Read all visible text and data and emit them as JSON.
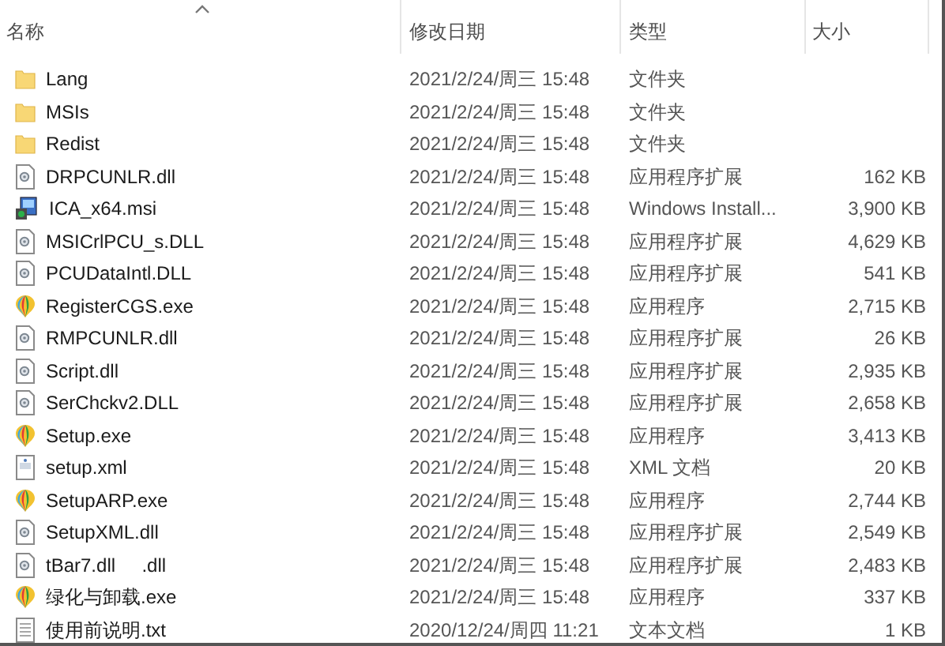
{
  "columns": [
    {
      "label": "名称",
      "sorted": true
    },
    {
      "label": "修改日期",
      "sorted": false
    },
    {
      "label": "类型",
      "sorted": false
    },
    {
      "label": "大小",
      "sorted": false
    }
  ],
  "rows": [
    {
      "kind": "folder",
      "name": "Lang",
      "date": "2021/2/24/周三 15:48",
      "type": "文件夹"
    },
    {
      "kind": "folder",
      "name": "MSIs",
      "date": "2021/2/24/周三 15:48",
      "type": "文件夹"
    },
    {
      "kind": "folder",
      "name": "Redist",
      "date": "2021/2/24/周三 15:48",
      "type": "文件夹"
    },
    {
      "kind": "dll",
      "name": "DRPCUNLR.dll",
      "date": "2021/2/24/周三 15:48",
      "type": "应用程序扩展",
      "size": "162 KB"
    },
    {
      "kind": "msi",
      "name": "ICA_x64.msi",
      "date": "2021/2/24/周三 15:48",
      "type": "Windows Install...",
      "size": "3,900 KB"
    },
    {
      "kind": "dll",
      "name": "MSICrlPCU_s.DLL",
      "date": "2021/2/24/周三 15:48",
      "type": "应用程序扩展",
      "size": "4,629 KB"
    },
    {
      "kind": "dll",
      "name": "PCUDataIntl.DLL",
      "date": "2021/2/24/周三 15:48",
      "type": "应用程序扩展",
      "size": "541 KB"
    },
    {
      "kind": "exe",
      "name": "RegisterCGS.exe",
      "date": "2021/2/24/周三 15:48",
      "type": "应用程序",
      "size": "2,715 KB"
    },
    {
      "kind": "dll",
      "name": "RMPCUNLR.dll",
      "date": "2021/2/24/周三 15:48",
      "type": "应用程序扩展",
      "size": "26 KB"
    },
    {
      "kind": "dll",
      "name": "Script.dll",
      "date": "2021/2/24/周三 15:48",
      "type": "应用程序扩展",
      "size": "2,935 KB"
    },
    {
      "kind": "dll",
      "name": "SerChckv2.DLL",
      "date": "2021/2/24/周三 15:48",
      "type": "应用程序扩展",
      "size": "2,658 KB"
    },
    {
      "kind": "exe",
      "name": "Setup.exe",
      "date": "2021/2/24/周三 15:48",
      "type": "应用程序",
      "size": "3,413 KB"
    },
    {
      "kind": "xml",
      "name": "setup.xml",
      "date": "2021/2/24/周三 15:48",
      "type": "XML 文档",
      "size": "20 KB"
    },
    {
      "kind": "exe",
      "name": "SetupARP.exe",
      "date": "2021/2/24/周三 15:48",
      "type": "应用程序",
      "size": "2,744 KB"
    },
    {
      "kind": "dll",
      "name": "SetupXML.dll",
      "date": "2021/2/24/周三 15:48",
      "type": "应用程序扩展",
      "size": "2,549 KB"
    },
    {
      "kind": "dll",
      "name": "tBar7.dll     .dll",
      "date": "2021/2/24/周三 15:48",
      "type": "应用程序扩展",
      "size": "2,483 KB"
    },
    {
      "kind": "exe",
      "name": "绿化与卸载.exe",
      "date": "2021/2/24/周三 15:48",
      "type": "应用程序",
      "size": "337 KB"
    },
    {
      "kind": "txt",
      "name": "使用前说明.txt",
      "date": "2020/12/24/周四 11:21",
      "type": "文本文档",
      "size": "1 KB"
    }
  ]
}
